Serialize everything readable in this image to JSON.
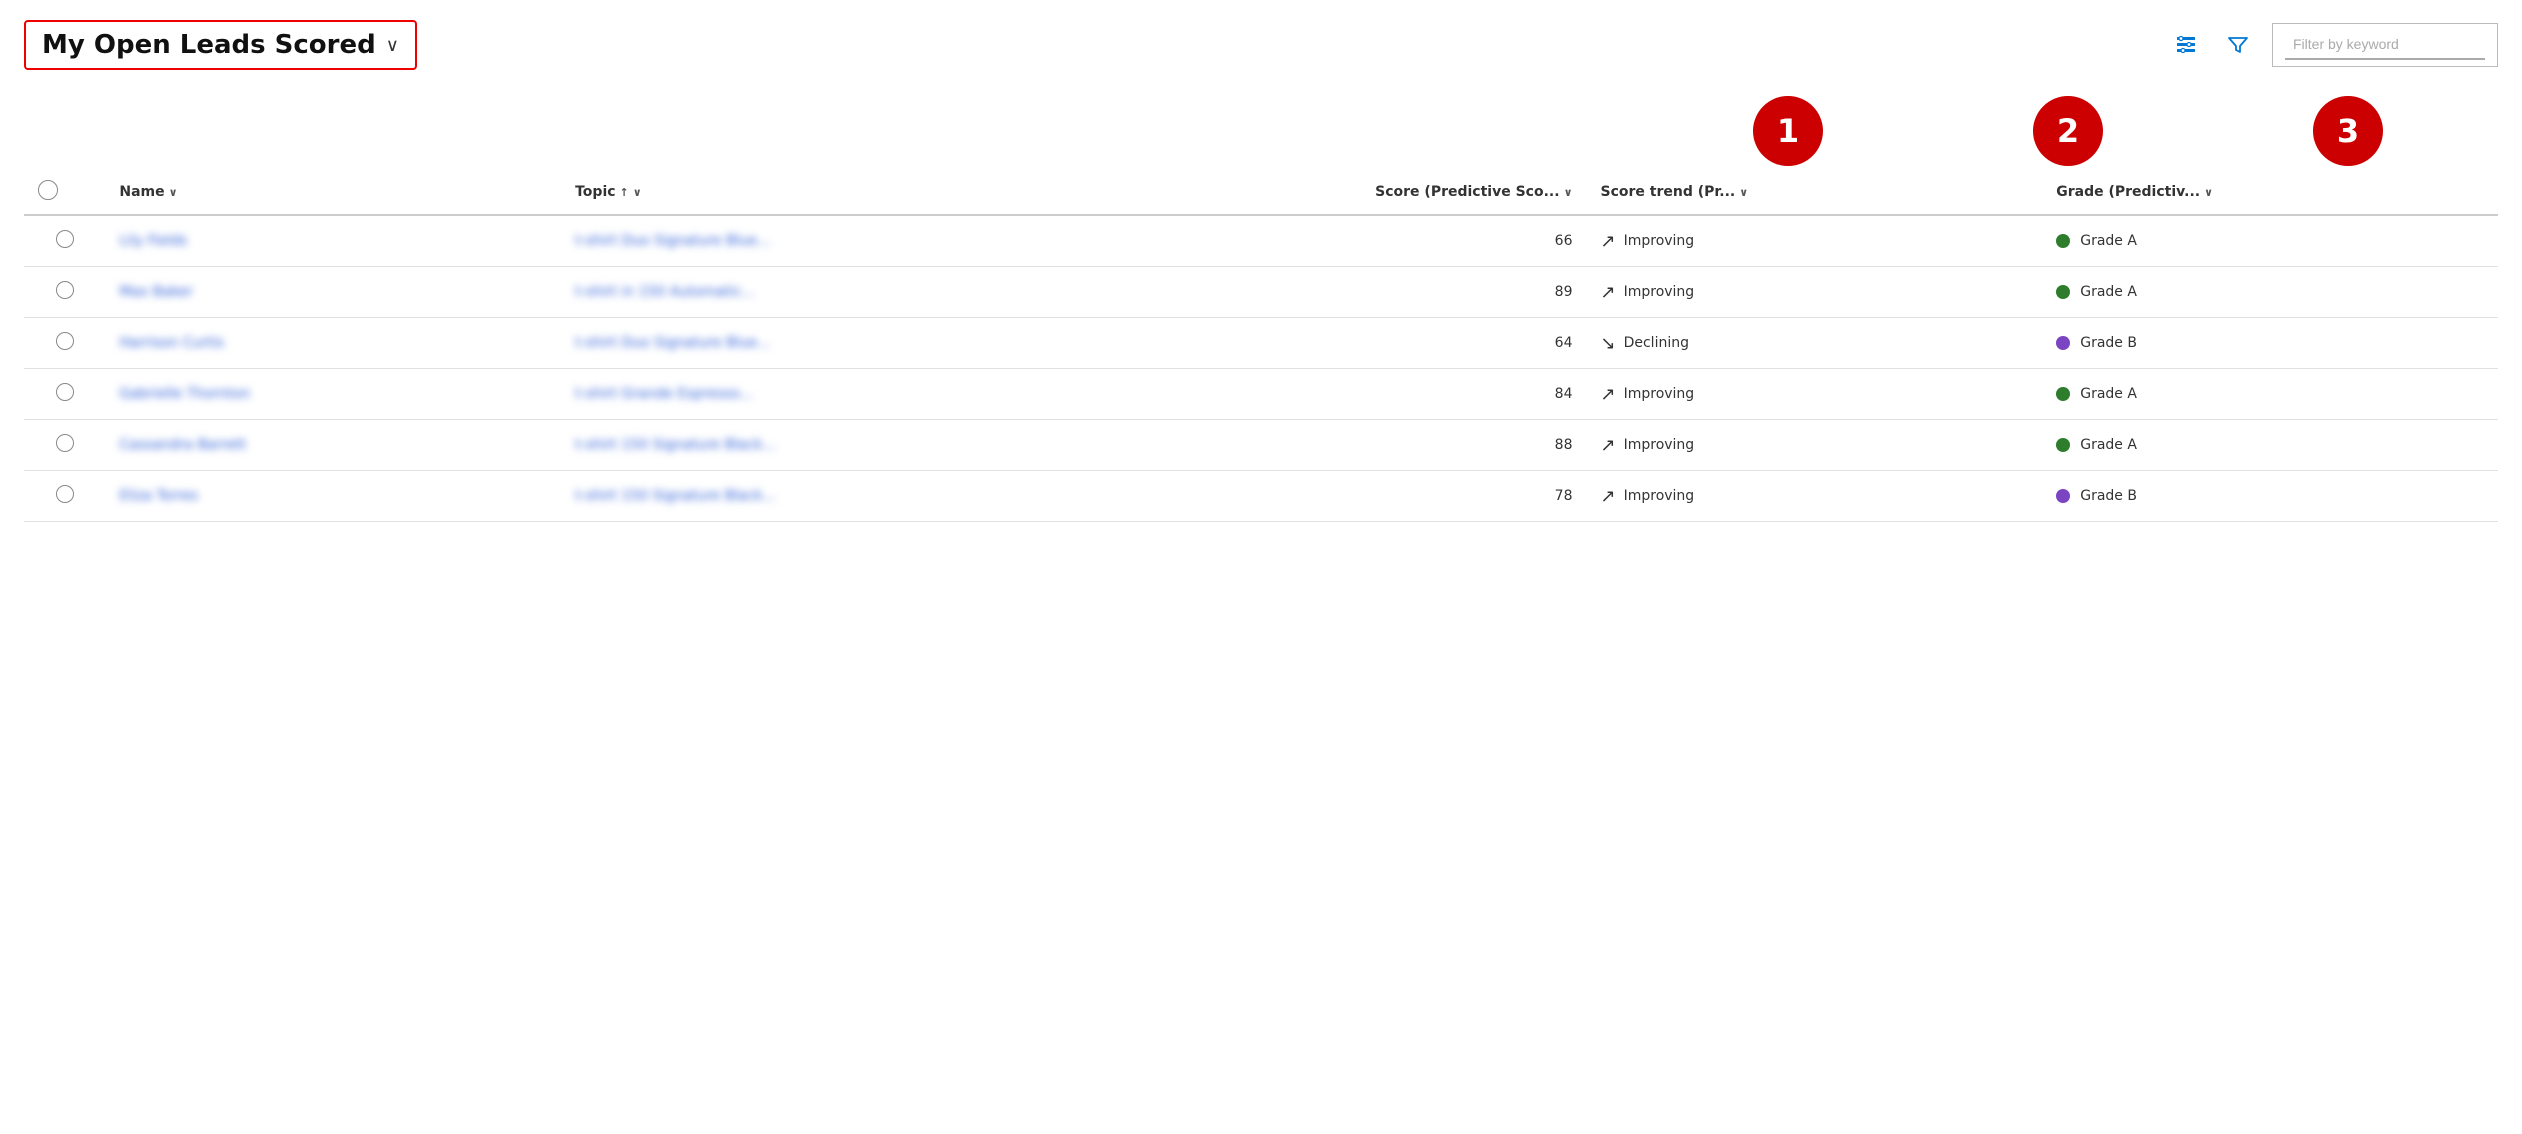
{
  "header": {
    "title": "My Open Leads Scored",
    "chevron": "∨",
    "filter_placeholder": "Filter by keyword"
  },
  "annotations": [
    {
      "number": "1"
    },
    {
      "number": "2"
    },
    {
      "number": "3"
    }
  ],
  "columns": {
    "name": "Name",
    "name_sort": "∨",
    "topic": "Topic",
    "topic_sort_asc": "↑",
    "topic_sort_desc": "∨",
    "score": "Score (Predictive Sco...",
    "score_sort": "∨",
    "score_trend": "Score trend (Pr...",
    "score_trend_sort": "∨",
    "grade": "Grade (Predictiv...",
    "grade_sort": "∨"
  },
  "rows": [
    {
      "name": "Lily Fields",
      "topic": "t-shirt Duo Signature Blue...",
      "score": 66,
      "trend": "up",
      "trend_label": "Improving",
      "grade_color": "green",
      "grade_label": "Grade A"
    },
    {
      "name": "Max Baker",
      "topic": "t-shirt in 150 Automatic...",
      "score": 89,
      "trend": "up",
      "trend_label": "Improving",
      "grade_color": "green",
      "grade_label": "Grade A"
    },
    {
      "name": "Harrison Curtis",
      "topic": "t-shirt Duo Signature Blue...",
      "score": 64,
      "trend": "down",
      "trend_label": "Declining",
      "grade_color": "purple",
      "grade_label": "Grade B"
    },
    {
      "name": "Gabrielle Thornton",
      "topic": "t-shirt Grande Espresso...",
      "score": 84,
      "trend": "up",
      "trend_label": "Improving",
      "grade_color": "green",
      "grade_label": "Grade A"
    },
    {
      "name": "Cassandra Barrett",
      "topic": "t-shirt 150 Signature Black...",
      "score": 88,
      "trend": "up",
      "trend_label": "Improving",
      "grade_color": "green",
      "grade_label": "Grade A"
    },
    {
      "name": "Eliza Torres",
      "topic": "t-shirt 150 Signature Black...",
      "score": 78,
      "trend": "up",
      "trend_label": "Improving",
      "grade_color": "purple",
      "grade_label": "Grade B"
    }
  ],
  "icons": {
    "customize_icon": "⊞",
    "filter_icon": "⛉"
  }
}
